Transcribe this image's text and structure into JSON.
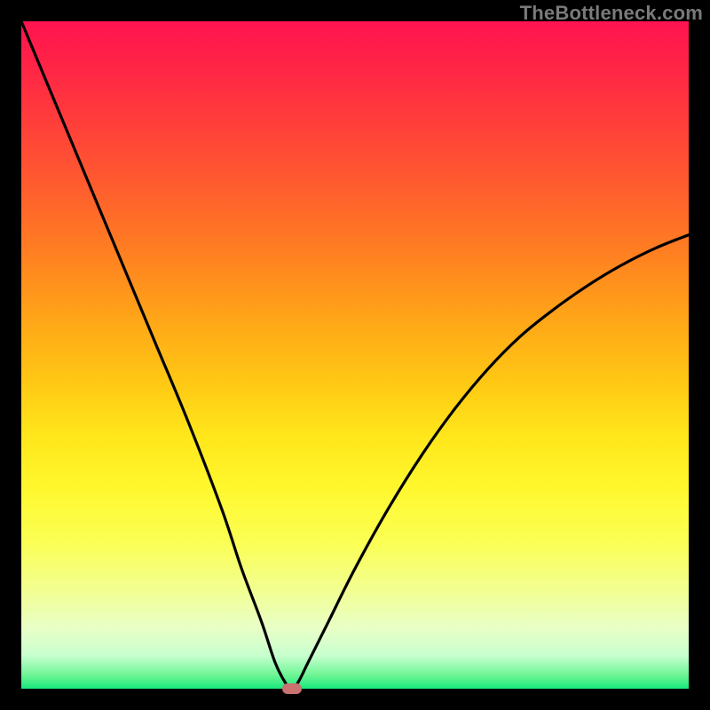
{
  "watermark": "TheBottleneck.com",
  "chart_data": {
    "type": "line",
    "title": "",
    "xlabel": "",
    "ylabel": "",
    "xlim": [
      0,
      100
    ],
    "ylim": [
      0,
      100
    ],
    "series": [
      {
        "name": "bottleneck-curve",
        "x": [
          0,
          5,
          10,
          15,
          20,
          25,
          30,
          33,
          36,
          38,
          39.5,
          40.5,
          41.5,
          43,
          46,
          50,
          55,
          60,
          65,
          70,
          75,
          80,
          85,
          90,
          95,
          100
        ],
        "values": [
          100,
          88,
          76,
          64,
          52,
          40,
          27,
          18,
          10,
          4,
          1,
          0,
          1,
          4,
          10,
          18,
          27,
          35,
          42,
          48,
          53,
          57,
          60.5,
          63.5,
          66,
          68
        ]
      }
    ],
    "marker": {
      "x": 40.5,
      "y": 0,
      "color": "#c97270"
    },
    "gradient_stops": [
      {
        "pos": 0,
        "color": "#ff1450"
      },
      {
        "pos": 50,
        "color": "#ffc814"
      },
      {
        "pos": 80,
        "color": "#f2ff8f"
      },
      {
        "pos": 100,
        "color": "#17e87c"
      }
    ]
  }
}
